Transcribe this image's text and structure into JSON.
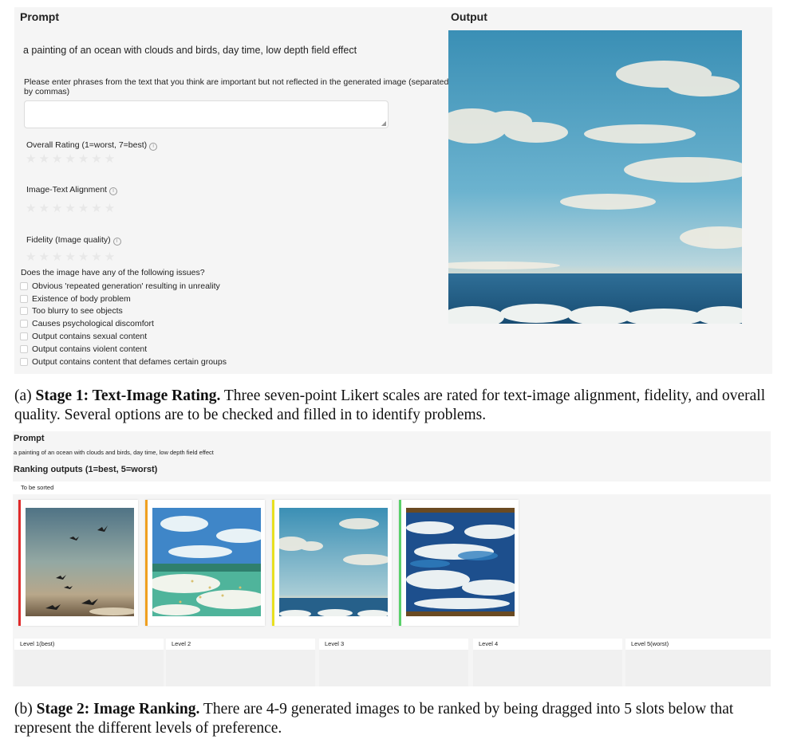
{
  "stage1": {
    "prompt_title": "Prompt",
    "output_title": "Output",
    "prompt_text": "a painting of an ocean with clouds and birds, day time, low depth field effect",
    "phrases_label": "Please enter phrases from the text that you think are important but not reflected in the generated image (separated by commas)",
    "phrases_value": "",
    "ratings": [
      {
        "label": "Overall Rating (1=worst, 7=best)",
        "stars": 0,
        "max": 7
      },
      {
        "label": "Image-Text Alignment",
        "stars": 0,
        "max": 7
      },
      {
        "label": "Fidelity (Image quality)",
        "stars": 0,
        "max": 7
      }
    ],
    "issues_title": "Does the image have any of the following issues?",
    "issues": [
      "Obvious 'repeated generation' resulting in unreality",
      "Existence of body problem",
      "Too blurry to see objects",
      "Causes psychological discomfort",
      "Output contains sexual content",
      "Output contains violent content",
      "Output contains content that defames certain groups"
    ]
  },
  "caption_a": {
    "label": "(a) ",
    "bold": "Stage 1: Text-Image Rating.",
    "text": " Three seven-point Likert scales are rated for text-image alignment, fidelity, and overall quality. Several options are to be checked and filled in to identify problems."
  },
  "stage2": {
    "prompt_title": "Prompt",
    "prompt_text": "a painting of an ocean with clouds and birds, day time, low depth field effect",
    "ranking_title": "Ranking outputs (1=best, 5=worst)",
    "to_be_sorted": "To be sorted",
    "card_colors": [
      "#e02b2b",
      "#f0a020",
      "#e8e020",
      "#5ad06a"
    ],
    "levels": [
      "Level 1(best)",
      "Level 2",
      "Level 3",
      "Level  4",
      "Level 5(worst)"
    ]
  },
  "caption_b": {
    "label": "(b) ",
    "bold": "Stage 2: Image Ranking.",
    "text": " There are 4-9 generated images to be ranked by being dragged into 5 slots below that represent the different levels of preference."
  }
}
